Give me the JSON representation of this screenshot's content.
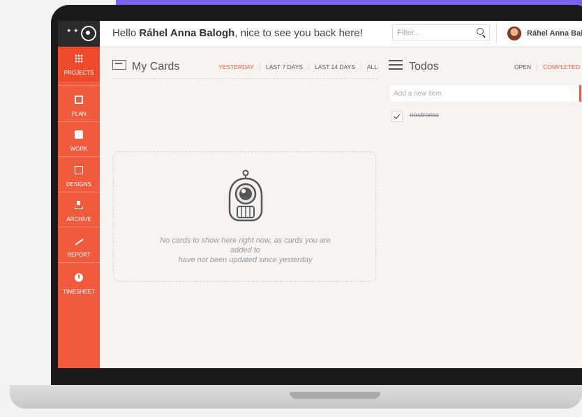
{
  "header": {
    "greeting_prefix": "Hello ",
    "user_name": "Ráhel Anna Balogh",
    "greeting_suffix": ", nice to see you back here!",
    "filter_placeholder": "Filter...",
    "profile_name": "Ráhel Anna Balo"
  },
  "sidebar": {
    "items": [
      {
        "label": "PROJECTS",
        "icon": "grid-icon"
      },
      {
        "label": "PLAN",
        "icon": "plan-icon"
      },
      {
        "label": "WORK",
        "icon": "briefcase-icon"
      },
      {
        "label": "DESIGNS",
        "icon": "image-icon"
      },
      {
        "label": "ARCHIVE",
        "icon": "archive-icon"
      },
      {
        "label": "REPORT",
        "icon": "trend-icon"
      },
      {
        "label": "TIMESHEET",
        "icon": "clock-icon"
      }
    ]
  },
  "cards": {
    "title": "My Cards",
    "tabs": [
      "YESTERDAY",
      "LAST 7 DAYS",
      "LAST 14 DAYS",
      "ALL"
    ],
    "active_tab": "YESTERDAY",
    "empty_line1": "No cards to show here right now, as cards you are",
    "empty_line2": "added to",
    "empty_line3": "have not been updated since yesterday"
  },
  "todos": {
    "title": "Todos",
    "tabs": [
      "OPEN",
      "COMPLETED"
    ],
    "active_tab": "COMPLETED",
    "new_item_placeholder": "Add a new item",
    "items": [
      {
        "text": "nostromo",
        "completed": true
      }
    ]
  },
  "colors": {
    "accent": "#f05b3d",
    "purple_strip": "#7b61ff",
    "background": "#f7f3f0",
    "logo_bg": "#2c2c2c"
  }
}
